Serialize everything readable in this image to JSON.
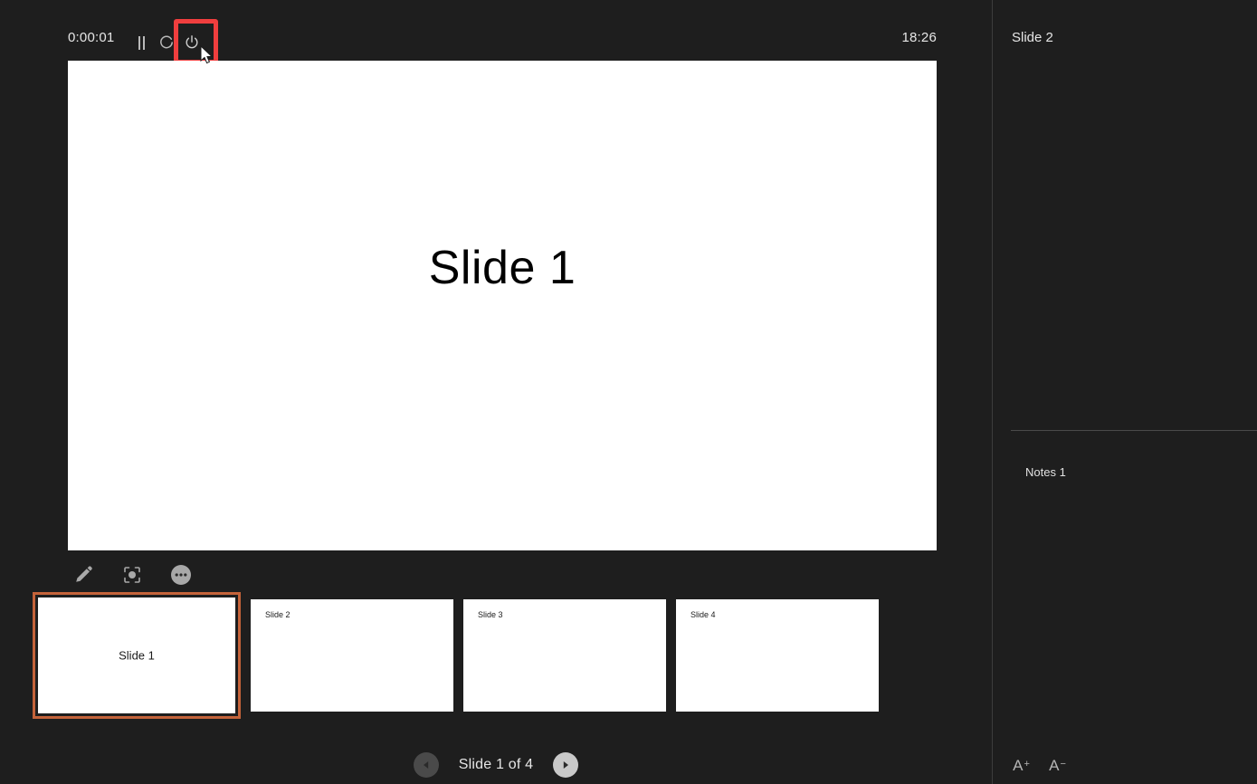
{
  "app": {
    "background_color": "#1e1e1e",
    "accent_color": "#c4633a",
    "highlight_color": "#f03e3e"
  },
  "control_bar": {
    "timer": "0:00:01",
    "clock": "18:26",
    "pause_icon": "pause-icon",
    "restart_icon": "restart-timer-icon",
    "power_icon": "power-icon",
    "pause_label": "Pause",
    "restart_label": "Restart",
    "power_label": "End slide show"
  },
  "current_slide": {
    "title": "Slide 1"
  },
  "slide_tools": [
    {
      "name": "pen-icon",
      "label": "Pen"
    },
    {
      "name": "laser-pointer-icon",
      "label": "Laser pointer"
    },
    {
      "name": "more-options-icon",
      "label": "More slide show options"
    }
  ],
  "thumbnails": [
    {
      "label": "Slide 1",
      "selected": true
    },
    {
      "label": "Slide 2",
      "selected": false
    },
    {
      "label": "Slide 3",
      "selected": false
    },
    {
      "label": "Slide 4",
      "selected": false
    }
  ],
  "navigation": {
    "counter": "Slide 1 of 4",
    "previous_icon": "previous-arrow-icon",
    "next_icon": "next-arrow-icon",
    "previous_enabled": false,
    "next_enabled": true
  },
  "notes_panel": {
    "next_slide_title": "Slide 2",
    "notes_text": "Notes 1",
    "increase_font_label": "A",
    "increase_font_sign": "+",
    "decrease_font_label": "A",
    "decrease_font_sign": "−"
  }
}
